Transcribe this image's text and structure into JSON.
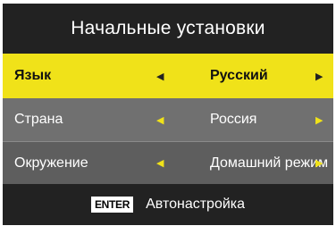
{
  "menu": {
    "title": "Начальные установки",
    "rows": [
      {
        "label": "Язык",
        "value": "Русский",
        "left_arrow": "◀",
        "right_arrow": "▶"
      },
      {
        "label": "Страна",
        "value": "Россия",
        "left_arrow": "◀",
        "right_arrow": "▶"
      },
      {
        "label": "Окружение",
        "value": "Домашний режим",
        "left_arrow": "◀",
        "right_arrow": "▶"
      }
    ],
    "footer": {
      "key_label": "ENTER",
      "action_label": "Автонастройка"
    }
  },
  "colors": {
    "highlight": "#f0e219",
    "panel": "#2b2b2b",
    "row": "#707070"
  }
}
